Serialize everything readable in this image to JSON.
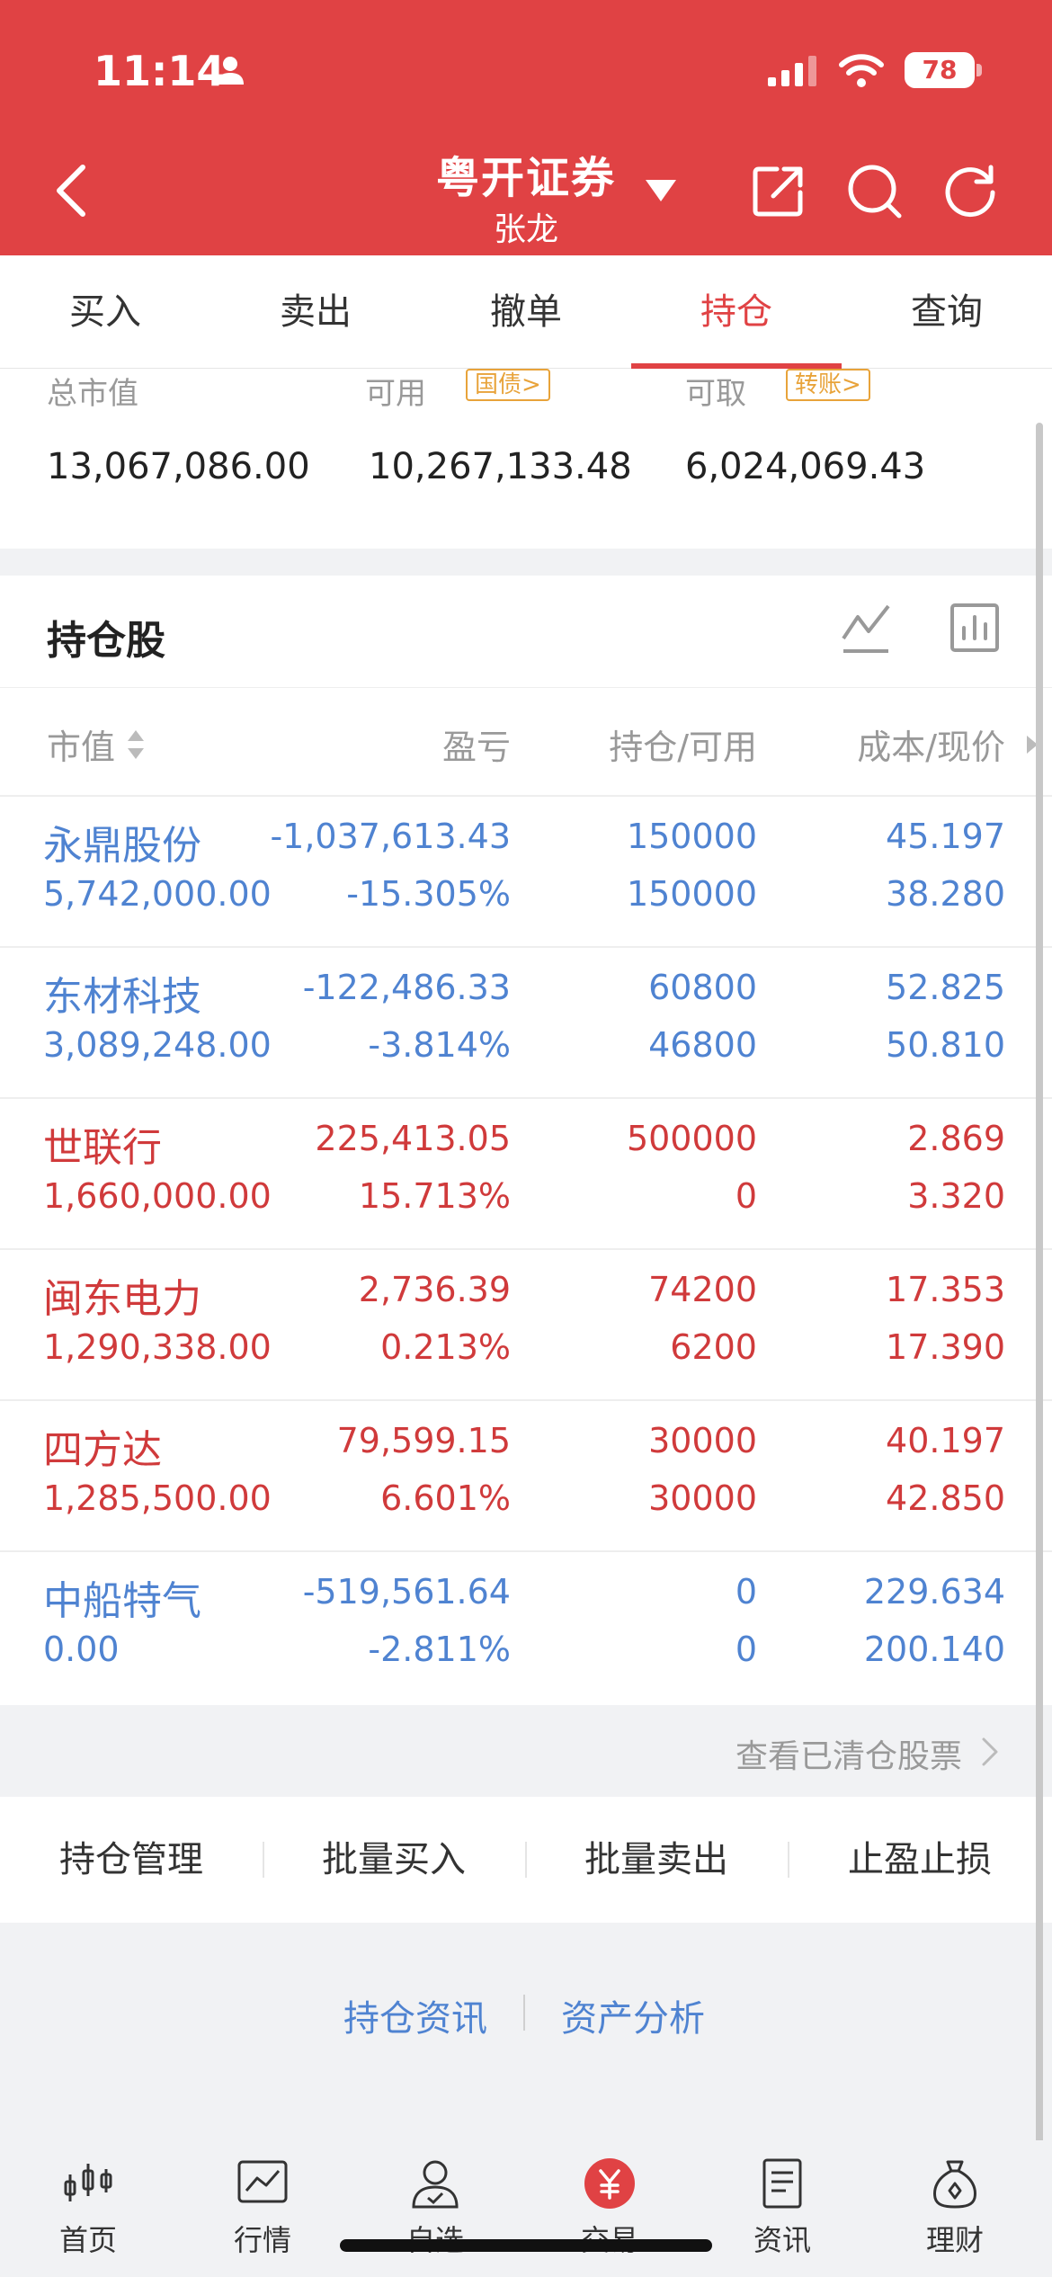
{
  "status_bar": {
    "time": "11:14",
    "battery": "78"
  },
  "header": {
    "title": "粤开证券",
    "subtitle": "张龙"
  },
  "tabs": [
    {
      "label": "买入"
    },
    {
      "label": "卖出"
    },
    {
      "label": "撤单"
    },
    {
      "label": "持仓",
      "active": true
    },
    {
      "label": "查询"
    }
  ],
  "summary": {
    "total_label": "总市值",
    "available_label": "可用",
    "available_badge": "国债>",
    "withdrawable_label": "可取",
    "withdrawable_badge": "转账>",
    "total_value": "13,067,086.00",
    "available_value": "10,267,133.48",
    "withdrawable_value": "6,024,069.43"
  },
  "holdings": {
    "title": "持仓股",
    "columns": {
      "market_value": "市值",
      "profit_loss": "盈亏",
      "position": "持仓/可用",
      "cost_price": "成本/现价"
    },
    "rows": [
      {
        "name": "永鼎股份",
        "market_value": "5,742,000.00",
        "pl": "-1,037,613.43",
        "pl_pct": "-15.305%",
        "position": "150000",
        "available": "150000",
        "cost": "45.197",
        "price": "38.280",
        "color": "blue"
      },
      {
        "name": "东材科技",
        "market_value": "3,089,248.00",
        "pl": "-122,486.33",
        "pl_pct": "-3.814%",
        "position": "60800",
        "available": "46800",
        "cost": "52.825",
        "price": "50.810",
        "color": "blue"
      },
      {
        "name": "世联行",
        "market_value": "1,660,000.00",
        "pl": "225,413.05",
        "pl_pct": "15.713%",
        "position": "500000",
        "available": "0",
        "cost": "2.869",
        "price": "3.320",
        "color": "red"
      },
      {
        "name": "闽东电力",
        "market_value": "1,290,338.00",
        "pl": "2,736.39",
        "pl_pct": "0.213%",
        "position": "74200",
        "available": "6200",
        "cost": "17.353",
        "price": "17.390",
        "color": "red"
      },
      {
        "name": "四方达",
        "market_value": "1,285,500.00",
        "pl": "79,599.15",
        "pl_pct": "6.601%",
        "position": "30000",
        "available": "30000",
        "cost": "40.197",
        "price": "42.850",
        "color": "red"
      },
      {
        "name": "中船特气",
        "market_value": "0.00",
        "pl": "-519,561.64",
        "pl_pct": "-2.811%",
        "position": "0",
        "available": "0",
        "cost": "229.634",
        "price": "200.140",
        "color": "blue"
      }
    ]
  },
  "cleared_link": "查看已清仓股票",
  "actions": [
    "持仓管理",
    "批量买入",
    "批量卖出",
    "止盈止损"
  ],
  "links": [
    "持仓资讯",
    "资产分析"
  ],
  "bottom_nav": [
    {
      "label": "首页",
      "icon": "candlestick-icon"
    },
    {
      "label": "行情",
      "icon": "trend-chart-icon"
    },
    {
      "label": "自选",
      "icon": "user-check-icon"
    },
    {
      "label": "交易",
      "icon": "yuan-coin-icon"
    },
    {
      "label": "资讯",
      "icon": "document-icon"
    },
    {
      "label": "理财",
      "icon": "money-bag-icon"
    }
  ],
  "colors": {
    "brand_red": "#e04244",
    "loss_blue": "#4f83d1",
    "gain_red": "#d03a3b",
    "badge_orange": "#e8a33a"
  }
}
